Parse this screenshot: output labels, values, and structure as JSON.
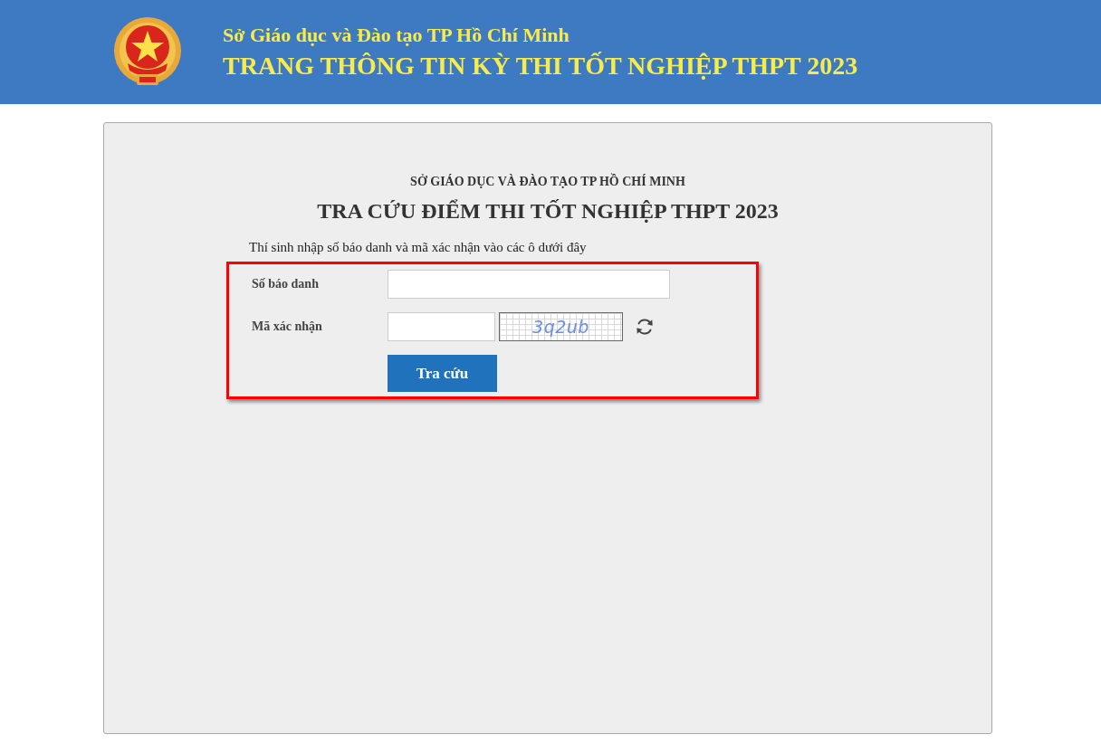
{
  "header": {
    "subtitle": "Sở Giáo dục và Đào tạo TP Hồ Chí Minh",
    "title": "TRANG THÔNG TIN KỲ THI TỐT NGHIỆP THPT 2023"
  },
  "lookup": {
    "department": "SỞ GIÁO DỤC VÀ ĐÀO TẠO TP HỒ CHÍ MINH",
    "title": "TRA CỨU ĐIỂM THI TỐT NGHIỆP THPT 2023",
    "instruction": "Thí sinh nhập số báo danh và mã xác nhận vào các ô dưới đây",
    "highlighted": true,
    "fields": [
      {
        "kind": "text",
        "label": "Số báo danh"
      },
      {
        "kind": "captcha",
        "label": "Mã xác nhận",
        "captcha": "3q2ub"
      }
    ],
    "submit": "Tra cứu"
  }
}
